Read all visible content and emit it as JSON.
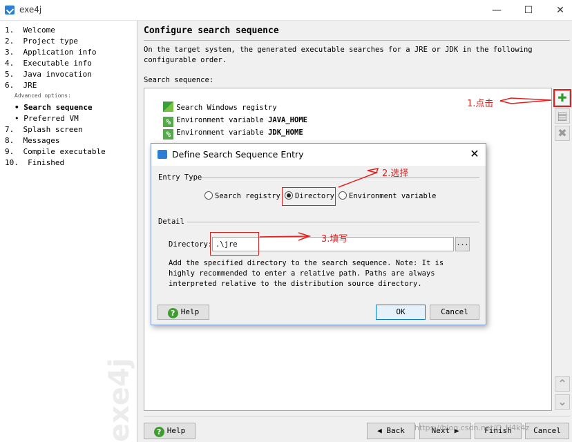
{
  "window": {
    "title": "exe4j",
    "minimize": "—",
    "maximize": "☐",
    "close": "✕"
  },
  "sidebar": {
    "steps": [
      "1.  Welcome",
      "2.  Project type",
      "3.  Application info",
      "4.  Executable info",
      "5.  Java invocation",
      "6.  JRE",
      "• Search sequence",
      "• Preferred VM",
      "7.  Splash screen",
      "8.  Messages",
      "9.  Compile executable",
      "10.  Finished"
    ],
    "advanced_label": "Advanced options:",
    "watermark": "exe4j"
  },
  "main": {
    "title": "Configure search sequence",
    "description": "On the target system, the generated executable searches for a JRE or JDK in the following configurable order.",
    "sequence_label": "Search sequence:",
    "items": [
      {
        "text": "Search Windows registry",
        "bold": ""
      },
      {
        "text": "Environment variable ",
        "bold": "JAVA_HOME"
      },
      {
        "text": "Environment variable ",
        "bold": "JDK_HOME"
      }
    ]
  },
  "tools": {
    "add": "✚",
    "edit": "▤",
    "remove": "✖",
    "up": "⌃",
    "down": "⌄"
  },
  "footer": {
    "help": "Help",
    "back": "◀ Back",
    "next": "Next ▶",
    "finish": "Finish",
    "cancel": "Cancel"
  },
  "dialog": {
    "title": "Define Search Sequence Entry",
    "close": "✕",
    "entry_type_label": "Entry Type",
    "options": [
      "Search registry",
      "Directory",
      "Environment variable"
    ],
    "selected": "Directory",
    "detail_label": "Detail",
    "directory_label": "Directory:",
    "directory_value": ".\\jre",
    "browse": "...",
    "description": "Add the specified directory to the search sequence. Note: It is highly recommended to enter a relative path. Paths are always interpreted relative to the distribution source directory.",
    "help": "Help",
    "ok": "OK",
    "cancel": "Cancel"
  },
  "annotations": {
    "step1": "1.点击",
    "step2": "2.选择",
    "step3": "3.填写"
  },
  "url_watermark": "https://blog.csdn.net/Q_H4k4z",
  "colors": {
    "annotation": "#e02020",
    "accent": "#0078d7",
    "plus_icon": "#2e9a2e"
  }
}
